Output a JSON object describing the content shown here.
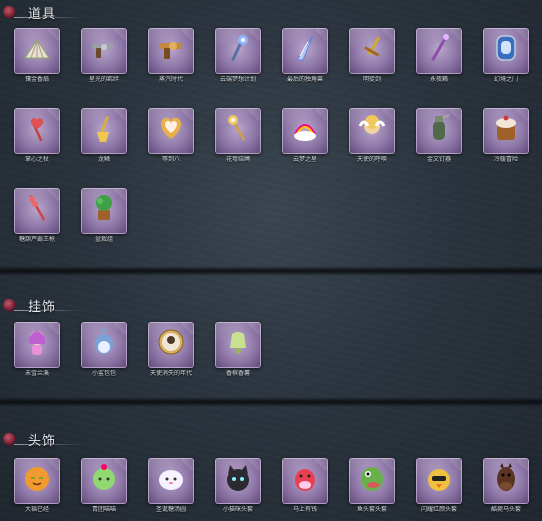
{
  "sections": {
    "props": {
      "title": "道具",
      "items": [
        {
          "label": "镶金香扇",
          "icon": "fan-icon"
        },
        {
          "label": "星光的羁绊",
          "icon": "revolver-icon"
        },
        {
          "label": "蒸汽时代",
          "icon": "steampunk-gun-icon"
        },
        {
          "label": "云端梦想计划",
          "icon": "scepter-icon"
        },
        {
          "label": "最后的独角兽",
          "icon": "unicorn-horn-icon"
        },
        {
          "label": "明徒剑",
          "icon": "sword-icon"
        },
        {
          "label": "永夜籁",
          "icon": "staff-icon"
        },
        {
          "label": "幻境之门",
          "icon": "magic-mirror-icon"
        },
        {
          "label": "掌心之杖",
          "icon": "heart-wand-icon"
        },
        {
          "label": "龙鳞",
          "icon": "golden-shovel-icon"
        },
        {
          "label": "等到八",
          "icon": "heart-mirror-icon"
        },
        {
          "label": "花萼结绳",
          "icon": "flower-wand-icon"
        },
        {
          "label": "云梦之星",
          "icon": "rainbow-cloud-icon"
        },
        {
          "label": "天使的呼唤",
          "icon": "angel-icon"
        },
        {
          "label": "金文钉器",
          "icon": "grenade-icon"
        },
        {
          "label": "冷暖冒险",
          "icon": "cake-mug-icon"
        },
        {
          "label": "糖葫芦霸王枪",
          "icon": "candy-spear-icon"
        },
        {
          "label": "盆栽组",
          "icon": "potted-plant-icon"
        }
      ]
    },
    "pendants": {
      "title": "挂饰",
      "items": [
        {
          "label": "未雪兰溪",
          "icon": "girl-doll-icon"
        },
        {
          "label": "小鲨包包",
          "icon": "shark-plush-icon"
        },
        {
          "label": "天使消失的年代",
          "icon": "portrait-frame-icon"
        },
        {
          "label": "香槟香薯",
          "icon": "bell-charm-icon"
        }
      ]
    },
    "headwear": {
      "title": "头饰",
      "items": [
        {
          "label": "大福已经",
          "icon": "orange-face-icon"
        },
        {
          "label": "青团喵喵",
          "icon": "green-bun-icon"
        },
        {
          "label": "圣诞糖汤圆",
          "icon": "rice-ball-icon"
        },
        {
          "label": "小猫咪头套",
          "icon": "black-cat-icon"
        },
        {
          "label": "马上有钱",
          "icon": "red-horse-icon"
        },
        {
          "label": "鱼头套头套",
          "icon": "fish-head-icon"
        },
        {
          "label": "闪耀红颜头套",
          "icon": "yellow-chick-icon"
        },
        {
          "label": "酷毙马头套",
          "icon": "horse-head-icon"
        }
      ]
    }
  },
  "colors": {
    "card_purple": "#8d76a6",
    "background": "#2b343e",
    "header_text": "#e6e9ee"
  }
}
